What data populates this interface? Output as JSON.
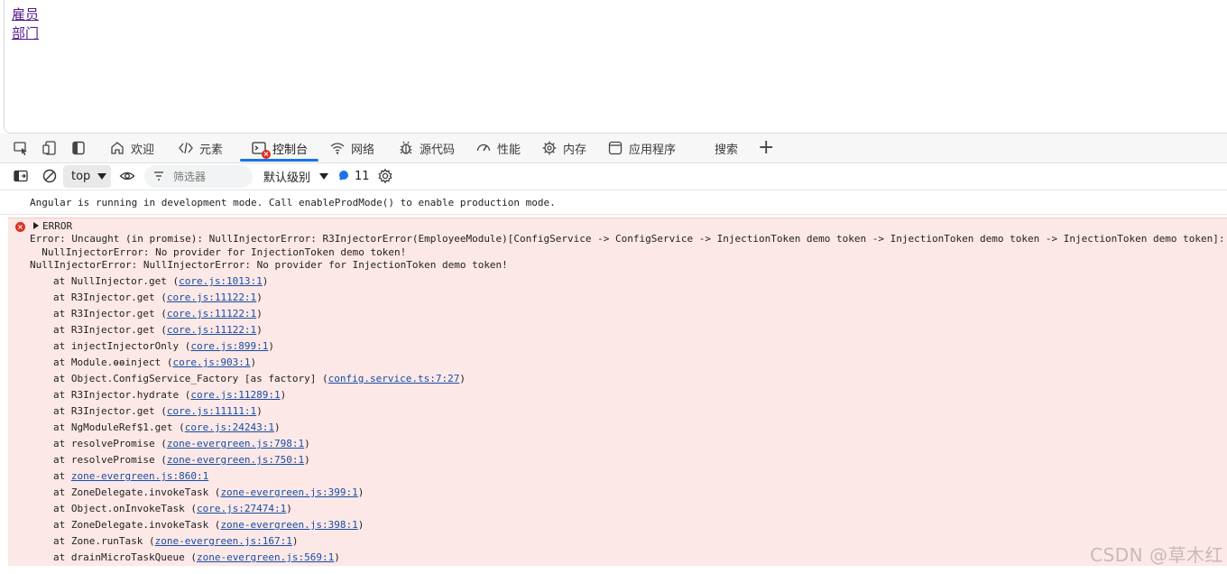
{
  "page": {
    "links": [
      "雇员",
      "部门"
    ]
  },
  "devtools": {
    "tabs": [
      {
        "label": "欢迎",
        "icon": "home-icon"
      },
      {
        "label": "元素",
        "icon": "code-icon"
      },
      {
        "label": "控制台",
        "icon": "console-icon",
        "active": true,
        "badge": "×"
      },
      {
        "label": "网络",
        "icon": "wifi-icon"
      },
      {
        "label": "源代码",
        "icon": "bug-icon"
      },
      {
        "label": "性能",
        "icon": "gauge-icon"
      },
      {
        "label": "内存",
        "icon": "memory-icon"
      },
      {
        "label": "应用程序",
        "icon": "window-icon"
      },
      {
        "label": "搜索",
        "icon": ""
      }
    ],
    "add_tab": "+",
    "toolbar": {
      "context": "top",
      "filter_placeholder": "筛选器",
      "level": "默认级别",
      "message_count": "11"
    }
  },
  "console": {
    "info_line": "Angular is running in development mode. Call enableProdMode() to enable production mode.",
    "error": {
      "icon_glyph": "×",
      "title": "ERROR",
      "message_lines": [
        "Error: Uncaught (in promise): NullInjectorError: R3InjectorError(EmployeeModule)[ConfigService -> ConfigService -> InjectionToken demo token -> InjectionToken demo token -> InjectionToken demo token]:",
        "  NullInjectorError: No provider for InjectionToken demo token!",
        "NullInjectorError: NullInjectorError: No provider for InjectionToken demo token!"
      ],
      "stack": [
        {
          "text": "at NullInjector.get (",
          "link": "core.js:1013:1",
          "tail": ")"
        },
        {
          "text": "at R3Injector.get (",
          "link": "core.js:11122:1",
          "tail": ")"
        },
        {
          "text": "at R3Injector.get (",
          "link": "core.js:11122:1",
          "tail": ")"
        },
        {
          "text": "at R3Injector.get (",
          "link": "core.js:11122:1",
          "tail": ")"
        },
        {
          "text": "at injectInjectorOnly (",
          "link": "core.js:899:1",
          "tail": ")"
        },
        {
          "text": "at Module.ɵɵinject (",
          "link": "core.js:903:1",
          "tail": ")"
        },
        {
          "text": "at Object.ConfigService_Factory [as factory] (",
          "link": "config.service.ts:7:27",
          "tail": ")"
        },
        {
          "text": "at R3Injector.hydrate (",
          "link": "core.js:11289:1",
          "tail": ")"
        },
        {
          "text": "at R3Injector.get (",
          "link": "core.js:11111:1",
          "tail": ")"
        },
        {
          "text": "at NgModuleRef$1.get (",
          "link": "core.js:24243:1",
          "tail": ")"
        },
        {
          "text": "at resolvePromise (",
          "link": "zone-evergreen.js:798:1",
          "tail": ")"
        },
        {
          "text": "at resolvePromise (",
          "link": "zone-evergreen.js:750:1",
          "tail": ")"
        },
        {
          "text": "at ",
          "link": "zone-evergreen.js:860:1",
          "tail": ""
        },
        {
          "text": "at ZoneDelegate.invokeTask (",
          "link": "zone-evergreen.js:399:1",
          "tail": ")"
        },
        {
          "text": "at Object.onInvokeTask (",
          "link": "core.js:27474:1",
          "tail": ")"
        },
        {
          "text": "at ZoneDelegate.invokeTask (",
          "link": "zone-evergreen.js:398:1",
          "tail": ")"
        },
        {
          "text": "at Zone.runTask (",
          "link": "zone-evergreen.js:167:1",
          "tail": ")"
        },
        {
          "text": "at drainMicroTaskQueue (",
          "link": "zone-evergreen.js:569:1",
          "tail": ")"
        }
      ]
    }
  },
  "watermark": "CSDN @草木红",
  "colors": {
    "accent": "#1a73e8",
    "error_bg": "#fce8e6",
    "error_red": "#d93025",
    "link_visited": "#551a8b"
  }
}
